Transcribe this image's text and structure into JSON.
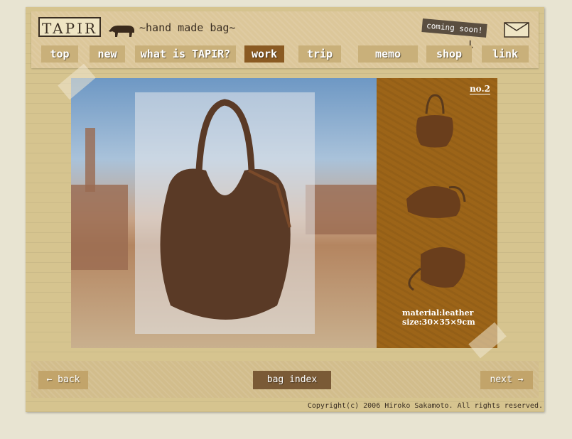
{
  "header": {
    "logo": "TAPIR",
    "tagline": "~hand made bag~",
    "coming_soon": "coming soon!"
  },
  "nav": {
    "items": [
      {
        "label": "top"
      },
      {
        "label": "new"
      },
      {
        "label": "what is TAPIR?"
      },
      {
        "label": "work",
        "active": true
      },
      {
        "label": "trip"
      },
      {
        "label": "memo"
      },
      {
        "label": "shop"
      },
      {
        "label": "link"
      }
    ]
  },
  "product": {
    "number": "no.2",
    "material": "material:leather",
    "size": "size:30×35×9cm"
  },
  "footer": {
    "back": "back",
    "index": "bag index",
    "next": "next"
  },
  "copyright": "Copyright(c) 2006 Hiroko Sakamoto. All rights reserved.",
  "colors": {
    "page": "#d6c48f",
    "side_panel": "#9c6418",
    "nav_active": "#8a5a22",
    "bag": "#5a3a26"
  },
  "icons": [
    "tapir-icon",
    "mail-icon",
    "arrow-left-icon",
    "arrow-right-icon"
  ]
}
